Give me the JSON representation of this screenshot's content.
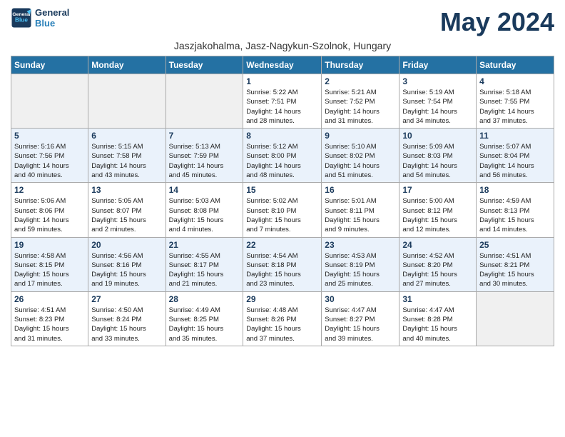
{
  "header": {
    "logo_line1": "General",
    "logo_line2": "Blue",
    "month_title": "May 2024",
    "subtitle": "Jaszjakohalma, Jasz-Nagykun-Szolnok, Hungary"
  },
  "days_of_week": [
    "Sunday",
    "Monday",
    "Tuesday",
    "Wednesday",
    "Thursday",
    "Friday",
    "Saturday"
  ],
  "weeks": [
    {
      "row_class": "row-white",
      "days": [
        {
          "num": "",
          "info": ""
        },
        {
          "num": "",
          "info": ""
        },
        {
          "num": "",
          "info": ""
        },
        {
          "num": "1",
          "info": "Sunrise: 5:22 AM\nSunset: 7:51 PM\nDaylight: 14 hours\nand 28 minutes."
        },
        {
          "num": "2",
          "info": "Sunrise: 5:21 AM\nSunset: 7:52 PM\nDaylight: 14 hours\nand 31 minutes."
        },
        {
          "num": "3",
          "info": "Sunrise: 5:19 AM\nSunset: 7:54 PM\nDaylight: 14 hours\nand 34 minutes."
        },
        {
          "num": "4",
          "info": "Sunrise: 5:18 AM\nSunset: 7:55 PM\nDaylight: 14 hours\nand 37 minutes."
        }
      ]
    },
    {
      "row_class": "row-blue",
      "days": [
        {
          "num": "5",
          "info": "Sunrise: 5:16 AM\nSunset: 7:56 PM\nDaylight: 14 hours\nand 40 minutes."
        },
        {
          "num": "6",
          "info": "Sunrise: 5:15 AM\nSunset: 7:58 PM\nDaylight: 14 hours\nand 43 minutes."
        },
        {
          "num": "7",
          "info": "Sunrise: 5:13 AM\nSunset: 7:59 PM\nDaylight: 14 hours\nand 45 minutes."
        },
        {
          "num": "8",
          "info": "Sunrise: 5:12 AM\nSunset: 8:00 PM\nDaylight: 14 hours\nand 48 minutes."
        },
        {
          "num": "9",
          "info": "Sunrise: 5:10 AM\nSunset: 8:02 PM\nDaylight: 14 hours\nand 51 minutes."
        },
        {
          "num": "10",
          "info": "Sunrise: 5:09 AM\nSunset: 8:03 PM\nDaylight: 14 hours\nand 54 minutes."
        },
        {
          "num": "11",
          "info": "Sunrise: 5:07 AM\nSunset: 8:04 PM\nDaylight: 14 hours\nand 56 minutes."
        }
      ]
    },
    {
      "row_class": "row-white",
      "days": [
        {
          "num": "12",
          "info": "Sunrise: 5:06 AM\nSunset: 8:06 PM\nDaylight: 14 hours\nand 59 minutes."
        },
        {
          "num": "13",
          "info": "Sunrise: 5:05 AM\nSunset: 8:07 PM\nDaylight: 15 hours\nand 2 minutes."
        },
        {
          "num": "14",
          "info": "Sunrise: 5:03 AM\nSunset: 8:08 PM\nDaylight: 15 hours\nand 4 minutes."
        },
        {
          "num": "15",
          "info": "Sunrise: 5:02 AM\nSunset: 8:10 PM\nDaylight: 15 hours\nand 7 minutes."
        },
        {
          "num": "16",
          "info": "Sunrise: 5:01 AM\nSunset: 8:11 PM\nDaylight: 15 hours\nand 9 minutes."
        },
        {
          "num": "17",
          "info": "Sunrise: 5:00 AM\nSunset: 8:12 PM\nDaylight: 15 hours\nand 12 minutes."
        },
        {
          "num": "18",
          "info": "Sunrise: 4:59 AM\nSunset: 8:13 PM\nDaylight: 15 hours\nand 14 minutes."
        }
      ]
    },
    {
      "row_class": "row-blue",
      "days": [
        {
          "num": "19",
          "info": "Sunrise: 4:58 AM\nSunset: 8:15 PM\nDaylight: 15 hours\nand 17 minutes."
        },
        {
          "num": "20",
          "info": "Sunrise: 4:56 AM\nSunset: 8:16 PM\nDaylight: 15 hours\nand 19 minutes."
        },
        {
          "num": "21",
          "info": "Sunrise: 4:55 AM\nSunset: 8:17 PM\nDaylight: 15 hours\nand 21 minutes."
        },
        {
          "num": "22",
          "info": "Sunrise: 4:54 AM\nSunset: 8:18 PM\nDaylight: 15 hours\nand 23 minutes."
        },
        {
          "num": "23",
          "info": "Sunrise: 4:53 AM\nSunset: 8:19 PM\nDaylight: 15 hours\nand 25 minutes."
        },
        {
          "num": "24",
          "info": "Sunrise: 4:52 AM\nSunset: 8:20 PM\nDaylight: 15 hours\nand 27 minutes."
        },
        {
          "num": "25",
          "info": "Sunrise: 4:51 AM\nSunset: 8:21 PM\nDaylight: 15 hours\nand 30 minutes."
        }
      ]
    },
    {
      "row_class": "row-white",
      "days": [
        {
          "num": "26",
          "info": "Sunrise: 4:51 AM\nSunset: 8:23 PM\nDaylight: 15 hours\nand 31 minutes."
        },
        {
          "num": "27",
          "info": "Sunrise: 4:50 AM\nSunset: 8:24 PM\nDaylight: 15 hours\nand 33 minutes."
        },
        {
          "num": "28",
          "info": "Sunrise: 4:49 AM\nSunset: 8:25 PM\nDaylight: 15 hours\nand 35 minutes."
        },
        {
          "num": "29",
          "info": "Sunrise: 4:48 AM\nSunset: 8:26 PM\nDaylight: 15 hours\nand 37 minutes."
        },
        {
          "num": "30",
          "info": "Sunrise: 4:47 AM\nSunset: 8:27 PM\nDaylight: 15 hours\nand 39 minutes."
        },
        {
          "num": "31",
          "info": "Sunrise: 4:47 AM\nSunset: 8:28 PM\nDaylight: 15 hours\nand 40 minutes."
        },
        {
          "num": "",
          "info": ""
        }
      ]
    }
  ]
}
